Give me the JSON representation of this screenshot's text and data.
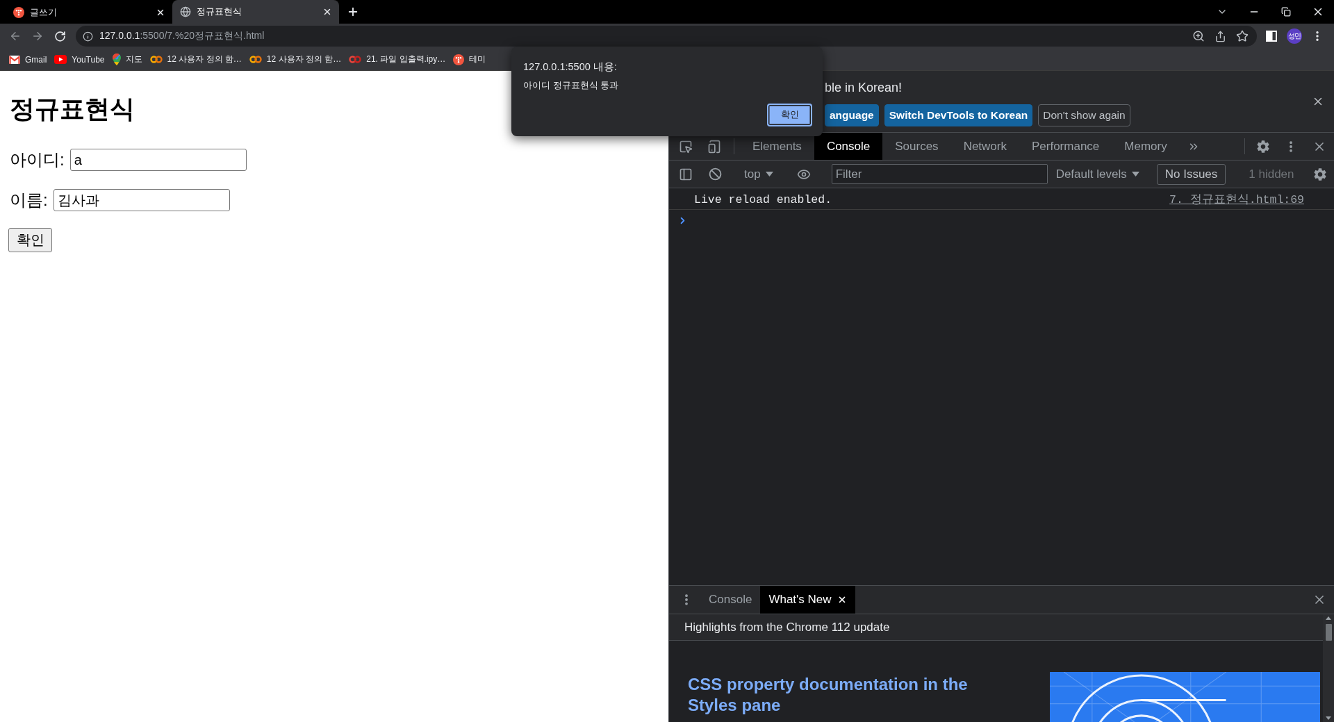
{
  "browser": {
    "tabs": [
      {
        "title": "글쓰기",
        "kind": "tistory",
        "selected": false
      },
      {
        "title": "정규표현식",
        "kind": "globe",
        "selected": true
      }
    ],
    "address": {
      "host": "127.0.0.1",
      "path": ":5500/7.%20정규표현식.html"
    },
    "profile": "성민",
    "bookmarks": [
      {
        "label": "Gmail",
        "kind": "gmail"
      },
      {
        "label": "YouTube",
        "kind": "youtube"
      },
      {
        "label": "지도",
        "kind": "maps"
      },
      {
        "label": "12 사용자 정의 함…",
        "kind": "colab"
      },
      {
        "label": "12 사용자 정의 함…",
        "kind": "colab"
      },
      {
        "label": "21. 파일 입출력.ipy…",
        "kind": "notebook"
      },
      {
        "label": "테미",
        "kind": "tistory"
      }
    ]
  },
  "page": {
    "heading": "정규표현식",
    "fields": [
      {
        "label": "아이디:",
        "value": "a"
      },
      {
        "label": "이름:",
        "value": "김사과"
      }
    ],
    "submit": "확인"
  },
  "dialog": {
    "title": "127.0.0.1:5500 내용:",
    "message": "아이디 정규표현식 통과",
    "button": "확인"
  },
  "devtools": {
    "infobar": {
      "message": "ble in Korean!",
      "buttons": [
        {
          "label": "anguage",
          "kind": "primary"
        },
        {
          "label": "Switch DevTools to Korean",
          "kind": "primary"
        },
        {
          "label": "Don't show again",
          "kind": "secondary"
        }
      ]
    },
    "tabs": [
      {
        "label": "Elements",
        "selected": false
      },
      {
        "label": "Console",
        "selected": true
      },
      {
        "label": "Sources",
        "selected": false
      },
      {
        "label": "Network",
        "selected": false
      },
      {
        "label": "Performance",
        "selected": false
      },
      {
        "label": "Memory",
        "selected": false
      }
    ],
    "console_toolbar": {
      "context": "top",
      "filter": {
        "placeholder": "Filter"
      },
      "levels": "Default levels",
      "issues": "No Issues",
      "hidden": "1 hidden"
    },
    "messages": [
      {
        "text": "Live reload enabled.",
        "source": "7. 정규표현식.html:69"
      }
    ],
    "drawer": {
      "tabs": [
        {
          "label": "Console",
          "selected": false,
          "closable": false
        },
        {
          "label": "What's New",
          "selected": true,
          "closable": true
        }
      ],
      "header": "Highlights from the Chrome 112 update",
      "article_title": "CSS property documentation in the Styles pane"
    }
  }
}
